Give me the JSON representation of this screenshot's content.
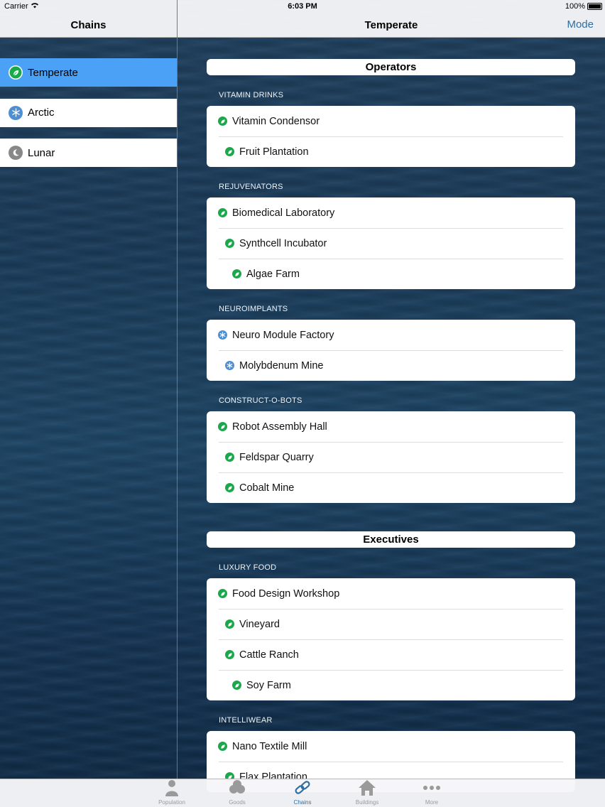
{
  "status_bar": {
    "carrier": "Carrier",
    "time": "6:03 PM",
    "battery": "100%"
  },
  "left_nav": {
    "title": "Chains"
  },
  "right_nav": {
    "title": "Temperate",
    "mode_label": "Mode"
  },
  "sidebar": {
    "items": [
      {
        "label": "Temperate",
        "icon": "leaf-icon",
        "selected": true
      },
      {
        "label": "Arctic",
        "icon": "snowflake-icon",
        "selected": false
      },
      {
        "label": "Lunar",
        "icon": "moon-icon",
        "selected": false
      }
    ]
  },
  "groups": [
    {
      "title": "Operators",
      "sections": [
        {
          "label": "VITAMIN DRINKS",
          "rows": [
            {
              "label": "Vitamin Condensor",
              "icon": "leaf",
              "level": 0
            },
            {
              "label": "Fruit Plantation",
              "icon": "leaf",
              "level": 1
            }
          ]
        },
        {
          "label": "REJUVENATORS",
          "rows": [
            {
              "label": "Biomedical Laboratory",
              "icon": "leaf",
              "level": 0
            },
            {
              "label": "Synthcell Incubator",
              "icon": "leaf",
              "level": 1
            },
            {
              "label": "Algae Farm",
              "icon": "leaf",
              "level": 2
            }
          ]
        },
        {
          "label": "NEUROIMPLANTS",
          "rows": [
            {
              "label": "Neuro Module Factory",
              "icon": "snow",
              "level": 0
            },
            {
              "label": "Molybdenum Mine",
              "icon": "snow",
              "level": 1
            }
          ]
        },
        {
          "label": "CONSTRUCT-O-BOTS",
          "rows": [
            {
              "label": "Robot Assembly Hall",
              "icon": "leaf",
              "level": 0
            },
            {
              "label": "Feldspar Quarry",
              "icon": "leaf",
              "level": 1
            },
            {
              "label": "Cobalt Mine",
              "icon": "leaf",
              "level": 1
            }
          ]
        }
      ]
    },
    {
      "title": "Executives",
      "sections": [
        {
          "label": "LUXURY FOOD",
          "rows": [
            {
              "label": "Food Design Workshop",
              "icon": "leaf",
              "level": 0
            },
            {
              "label": "Vineyard",
              "icon": "leaf",
              "level": 1
            },
            {
              "label": "Cattle Ranch",
              "icon": "leaf",
              "level": 1
            },
            {
              "label": "Soy Farm",
              "icon": "leaf",
              "level": 2
            }
          ]
        },
        {
          "label": "INTELLIWEAR",
          "rows": [
            {
              "label": "Nano Textile Mill",
              "icon": "leaf",
              "level": 0
            },
            {
              "label": "Flax Plantation",
              "icon": "leaf",
              "level": 1
            }
          ]
        }
      ]
    }
  ],
  "tabbar": {
    "items": [
      {
        "label": "Population",
        "icon": "person-icon",
        "active": false
      },
      {
        "label": "Goods",
        "icon": "goods-icon",
        "active": false
      },
      {
        "label": "Chains",
        "icon": "chain-link-icon",
        "active": true
      },
      {
        "label": "Buildings",
        "icon": "house-icon",
        "active": false
      },
      {
        "label": "More",
        "icon": "more-dots-icon",
        "active": false
      }
    ]
  },
  "colors": {
    "accent": "#2f6ea3",
    "selected_row": "#4aa1f5",
    "leaf_green": "#1aa84b",
    "snow_blue": "#4f8fd1"
  }
}
